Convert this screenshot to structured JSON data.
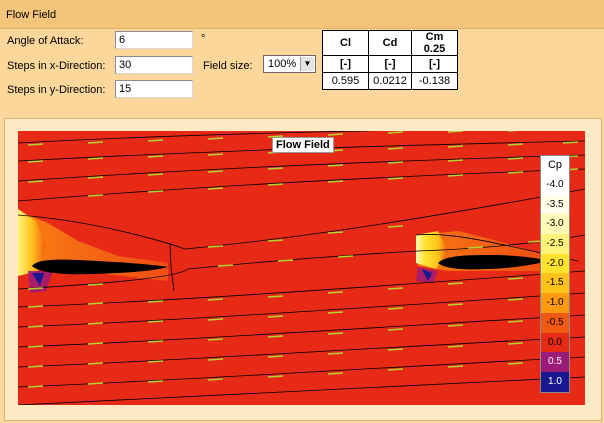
{
  "panel": {
    "title": "Flow Field"
  },
  "params": {
    "angle_label": "Angle of Attack:",
    "angle_value": "6",
    "angle_unit": "°",
    "steps_x_label": "Steps in x-Direction:",
    "steps_x_value": "30",
    "steps_y_label": "Steps in y-Direction:",
    "steps_y_value": "15",
    "field_size_label": "Field size:",
    "field_size_value": "100%"
  },
  "coefficients": {
    "headers": [
      "Cl",
      "Cd",
      "Cm 0.25"
    ],
    "units": [
      "[-]",
      "[-]",
      "[-]"
    ],
    "values": [
      "0.595",
      "0.0212",
      "-0.138"
    ]
  },
  "plot": {
    "title": "Flow Field",
    "legend_title": "Cp",
    "legend_items": [
      {
        "label": "-4.0",
        "color": "#ffffff"
      },
      {
        "label": "-3.5",
        "color": "#fffde8"
      },
      {
        "label": "-3.0",
        "color": "#fff9b8"
      },
      {
        "label": "-2.5",
        "color": "#fff27a"
      },
      {
        "label": "-2.0",
        "color": "#ffe12e"
      },
      {
        "label": "-1.5",
        "color": "#ffc21a"
      },
      {
        "label": "-1.0",
        "color": "#ff9a12"
      },
      {
        "label": "-0.5",
        "color": "#f25a14"
      },
      {
        "label": "0.0",
        "color": "#e62a16"
      },
      {
        "label": "0.5",
        "color": "#9c1a78"
      },
      {
        "label": "1.0",
        "color": "#1a1890"
      }
    ],
    "streamline_color": "#000000",
    "vector_color": "#b5d232"
  }
}
